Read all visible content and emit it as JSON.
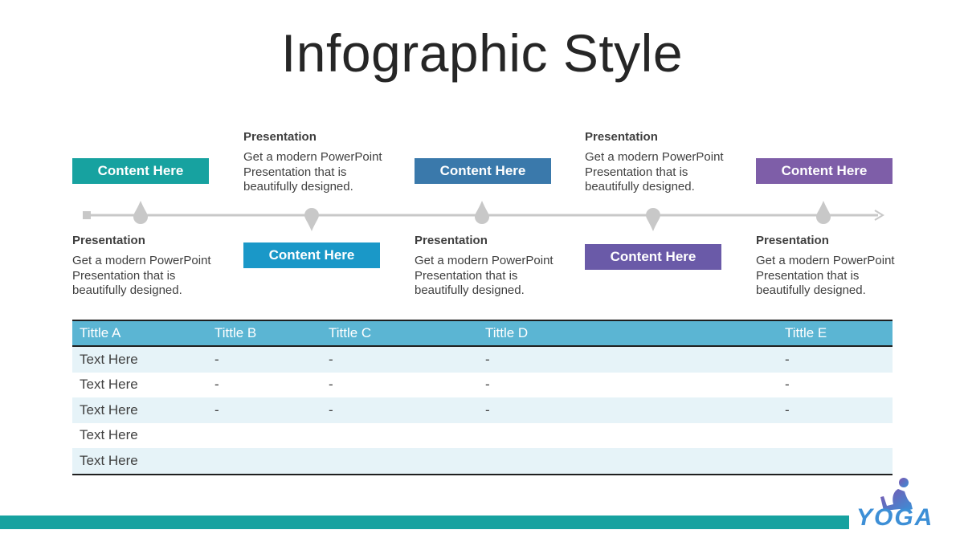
{
  "title": "Infographic Style",
  "colors": {
    "teal": "#17a2a0",
    "blue_light": "#1a98c8",
    "blue_dark": "#3a79ab",
    "purple": "#6a5aa8",
    "purple_light": "#7e5ea8",
    "table_header": "#5bb5d3",
    "timeline": "#c8c8c8"
  },
  "timeline": {
    "items": [
      {
        "box_label": "Content Here",
        "heading": "Presentation",
        "body": "Get a modern PowerPoint Presentation that is beautifully designed.",
        "position": "top-box"
      },
      {
        "box_label": "Content Here",
        "heading": "Presentation",
        "body": "Get a modern PowerPoint Presentation that is beautifully designed.",
        "position": "bottom-box"
      },
      {
        "box_label": "Content Here",
        "heading": "Presentation",
        "body": "Get a modern PowerPoint Presentation that is beautifully designed.",
        "position": "top-box"
      },
      {
        "box_label": "Content Here",
        "heading": "Presentation",
        "body": "Get a modern PowerPoint Presentation that is beautifully designed.",
        "position": "bottom-box"
      },
      {
        "box_label": "Content Here",
        "heading": "Presentation",
        "body": "Get a modern PowerPoint Presentation that is beautifully designed.",
        "position": "top-box"
      }
    ]
  },
  "table": {
    "headers": [
      "Tittle A",
      "Tittle B",
      "Tittle C",
      "Tittle D",
      "Tittle E"
    ],
    "rows": [
      [
        "Text Here",
        "-",
        "-",
        "-",
        "-"
      ],
      [
        "Text Here",
        "-",
        "-",
        "-",
        "-"
      ],
      [
        "Text Here",
        "-",
        "-",
        "-",
        "-"
      ],
      [
        "Text Here",
        "",
        "",
        "",
        ""
      ],
      [
        "Text Here",
        "",
        "",
        "",
        ""
      ]
    ]
  },
  "logo": {
    "word": "YOGA"
  }
}
